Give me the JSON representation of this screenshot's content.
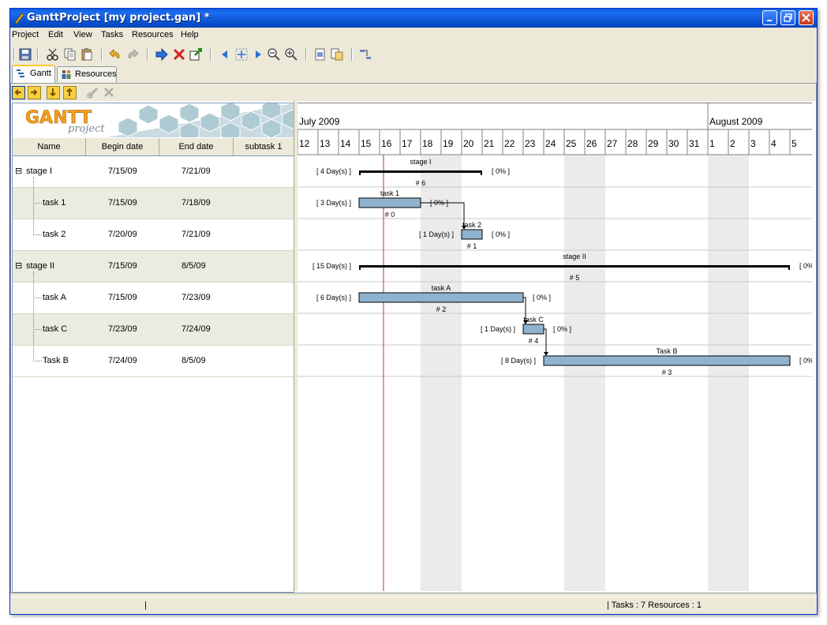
{
  "window": {
    "title": "GanttProject [my  project.gan] *"
  },
  "menu": [
    "Project",
    "Edit",
    "View",
    "Tasks",
    "Resources",
    "Help"
  ],
  "tabs": {
    "gantt": "Gantt",
    "resources": "Resources"
  },
  "logo": {
    "word1": "GANTT",
    "word2": "project"
  },
  "columns": {
    "name": "Name",
    "begin": "Begin date",
    "end": "End date",
    "custom": "subtask 1"
  },
  "rows": [
    {
      "name": "stage I",
      "begin": "7/15/09",
      "end": "7/21/09",
      "level": 0,
      "expander": "⊟"
    },
    {
      "name": "task 1",
      "begin": "7/15/09",
      "end": "7/18/09",
      "level": 1
    },
    {
      "name": "task 2",
      "begin": "7/20/09",
      "end": "7/21/09",
      "level": 1
    },
    {
      "name": "stage II",
      "begin": "7/15/09",
      "end": "8/5/09",
      "level": 0,
      "expander": "⊟"
    },
    {
      "name": "task A",
      "begin": "7/15/09",
      "end": "7/23/09",
      "level": 1
    },
    {
      "name": "task C",
      "begin": "7/23/09",
      "end": "7/24/09",
      "level": 1
    },
    {
      "name": "Task B",
      "begin": "7/24/09",
      "end": "8/5/09",
      "level": 1
    }
  ],
  "timeline": {
    "months": [
      "July 2009",
      "August 2009"
    ],
    "days": [
      "12",
      "13",
      "14",
      "15",
      "16",
      "17",
      "18",
      "19",
      "20",
      "21",
      "22",
      "23",
      "24",
      "25",
      "26",
      "27",
      "28",
      "29",
      "30",
      "31",
      "1",
      "2",
      "3",
      "4",
      "5"
    ]
  },
  "bars": [
    {
      "label": "stage I",
      "summary": true,
      "duration": "[ 4 Day(s) ]",
      "progress": "[ 0% ]",
      "id": "# 6"
    },
    {
      "label": "task 1",
      "summary": false,
      "duration": "[ 3 Day(s) ]",
      "progress": "[ 0% ]",
      "id": "# 0"
    },
    {
      "label": "task 2",
      "summary": false,
      "duration": "[ 1 Day(s) ]",
      "progress": "[ 0% ]",
      "id": "# 1"
    },
    {
      "label": "stage II",
      "summary": true,
      "duration": "[ 15 Day(s) ]",
      "progress": "[ 0%",
      "id": "# 5"
    },
    {
      "label": "task A",
      "summary": false,
      "duration": "[ 6 Day(s) ]",
      "progress": "[ 0% ]",
      "id": "# 2"
    },
    {
      "label": "task C",
      "summary": false,
      "duration": "[ 1 Day(s) ]",
      "progress": "[ 0% ]",
      "id": "# 4"
    },
    {
      "label": "Task B",
      "summary": false,
      "duration": "[ 8 Day(s) ]",
      "progress": "[ 0%",
      "id": "# 3"
    }
  ],
  "status": {
    "divider": "|",
    "text": "|  Tasks : 7  Resources : 1"
  }
}
